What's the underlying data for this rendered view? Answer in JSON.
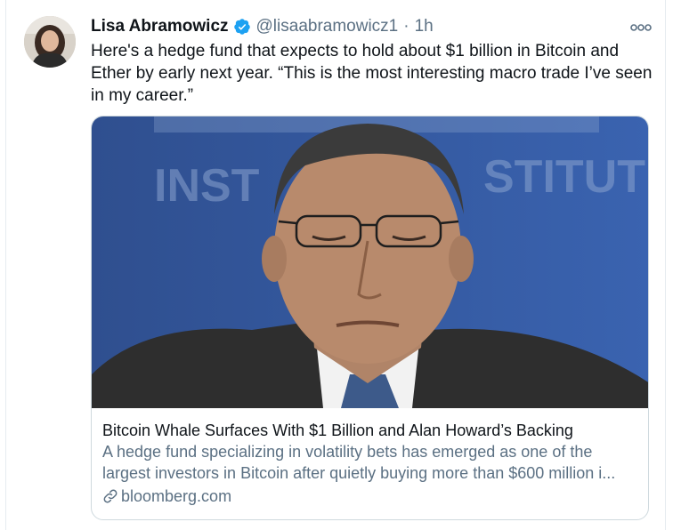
{
  "author": {
    "name": "Lisa Abramowicz",
    "handle": "@lisaabramowicz1",
    "separator": "·",
    "time": "1h",
    "verified": true
  },
  "tweet_text": "Here's a hedge fund that expects to hold about $1 billion in Bitcoin and Ether by early next year. “This is the most interesting macro trade I’ve seen in my career.”",
  "card": {
    "title": "Bitcoin Whale Surfaces With $1 Billion and Alan Howard’s Backing",
    "description": "A hedge fund specializing in volatility bets has emerged as one of the largest investors in Bitcoin after quietly buying more than $600 million i...",
    "domain": "bloomberg.com"
  },
  "colors": {
    "text_primary": "#0f1419",
    "text_secondary": "#5b7083",
    "verified_blue": "#1da1f2",
    "border": "#cfd9de"
  },
  "icons": [
    "verified-badge-icon",
    "more-options-icon",
    "link-icon"
  ]
}
